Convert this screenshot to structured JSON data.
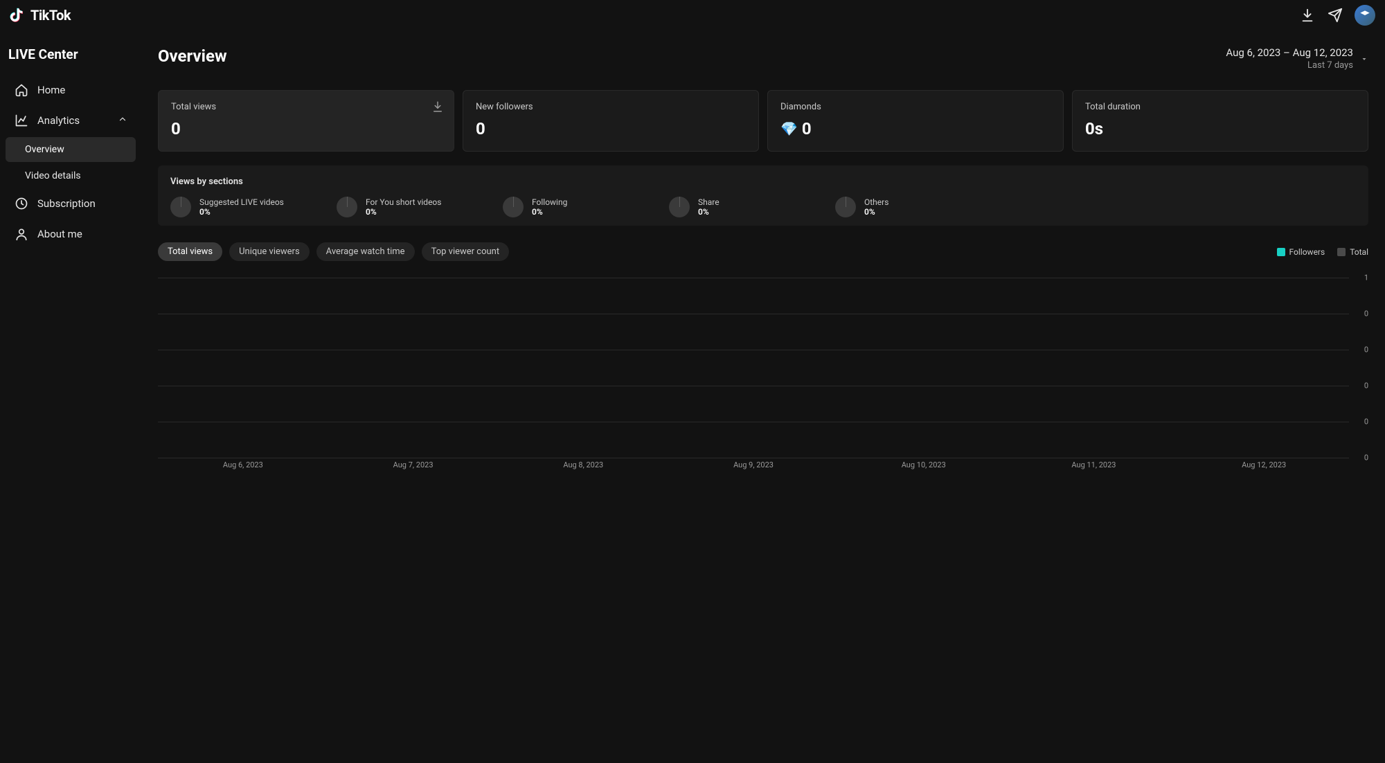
{
  "brand": {
    "name": "TikTok"
  },
  "sidebar": {
    "title": "LIVE Center",
    "items": [
      {
        "label": "Home"
      },
      {
        "label": "Analytics",
        "expanded": true,
        "children": [
          {
            "label": "Overview",
            "active": true
          },
          {
            "label": "Video details"
          }
        ]
      },
      {
        "label": "Subscription"
      },
      {
        "label": "About me"
      }
    ]
  },
  "page": {
    "title": "Overview",
    "date_range": "Aug 6, 2023 – Aug 12, 2023",
    "date_sub": "Last 7 days"
  },
  "stats": [
    {
      "label": "Total views",
      "value": "0",
      "has_download": true,
      "active": true
    },
    {
      "label": "New followers",
      "value": "0"
    },
    {
      "label": "Diamonds",
      "value": "0",
      "is_diamonds": true
    },
    {
      "label": "Total duration",
      "value": "0s"
    }
  ],
  "sections": {
    "title": "Views by sections",
    "items": [
      {
        "label": "Suggested LIVE videos",
        "value": "0%"
      },
      {
        "label": "For You short videos",
        "value": "0%"
      },
      {
        "label": "Following",
        "value": "0%"
      },
      {
        "label": "Share",
        "value": "0%"
      },
      {
        "label": "Others",
        "value": "0%"
      }
    ]
  },
  "chart_tabs": [
    {
      "label": "Total views",
      "active": true
    },
    {
      "label": "Unique viewers"
    },
    {
      "label": "Average watch time"
    },
    {
      "label": "Top viewer count"
    }
  ],
  "legend": {
    "followers": "Followers",
    "total": "Total"
  },
  "chart_data": {
    "type": "line",
    "title": "",
    "xlabel": "",
    "ylabel": "",
    "ylim": [
      0,
      1
    ],
    "y_ticks": [
      "1",
      "0",
      "0",
      "0",
      "0",
      "0"
    ],
    "categories": [
      "Aug 6, 2023",
      "Aug 7, 2023",
      "Aug 8, 2023",
      "Aug 9, 2023",
      "Aug 10, 2023",
      "Aug 11, 2023",
      "Aug 12, 2023"
    ],
    "series": [
      {
        "name": "Followers",
        "values": [
          0,
          0,
          0,
          0,
          0,
          0,
          0
        ]
      },
      {
        "name": "Total",
        "values": [
          0,
          0,
          0,
          0,
          0,
          0,
          0
        ]
      }
    ]
  }
}
